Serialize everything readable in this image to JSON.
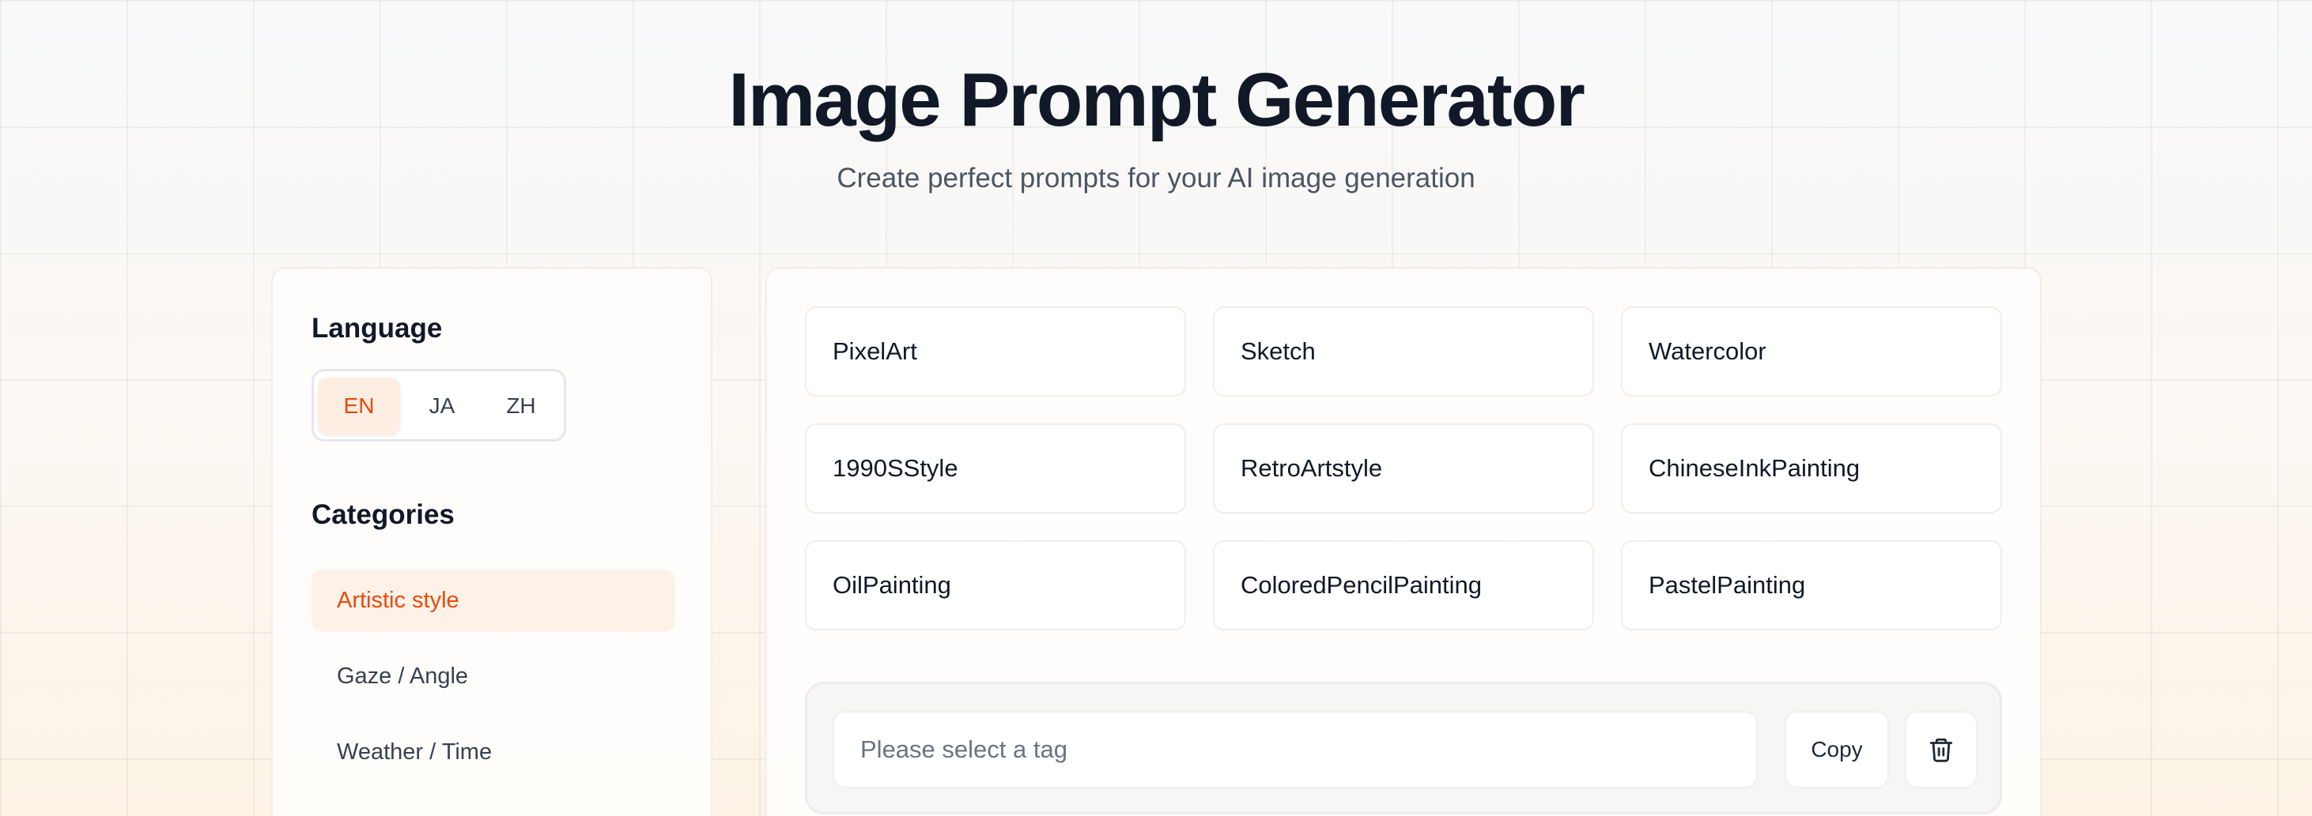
{
  "header": {
    "title": "Image Prompt Generator",
    "subtitle": "Create perfect prompts for your AI image generation"
  },
  "sidebar": {
    "language_heading": "Language",
    "languages": [
      {
        "label": "EN",
        "active": true
      },
      {
        "label": "JA",
        "active": false
      },
      {
        "label": "ZH",
        "active": false
      }
    ],
    "categories_heading": "Categories",
    "categories": [
      {
        "label": "Artistic style",
        "active": true
      },
      {
        "label": "Gaze / Angle",
        "active": false
      },
      {
        "label": "Weather / Time",
        "active": false
      }
    ]
  },
  "tags": [
    "PixelArt",
    "Sketch",
    "Watercolor",
    "1990SStyle",
    "RetroArtstyle",
    "ChineseInkPainting",
    "OilPainting",
    "ColoredPencilPainting",
    "PastelPainting"
  ],
  "prompt": {
    "placeholder": "Please select a tag",
    "value": "",
    "copy_label": "Copy",
    "delete_icon": "trash-icon"
  },
  "colors": {
    "accent": "#ea4a0c",
    "accent_bg": "#fdf2e8"
  }
}
